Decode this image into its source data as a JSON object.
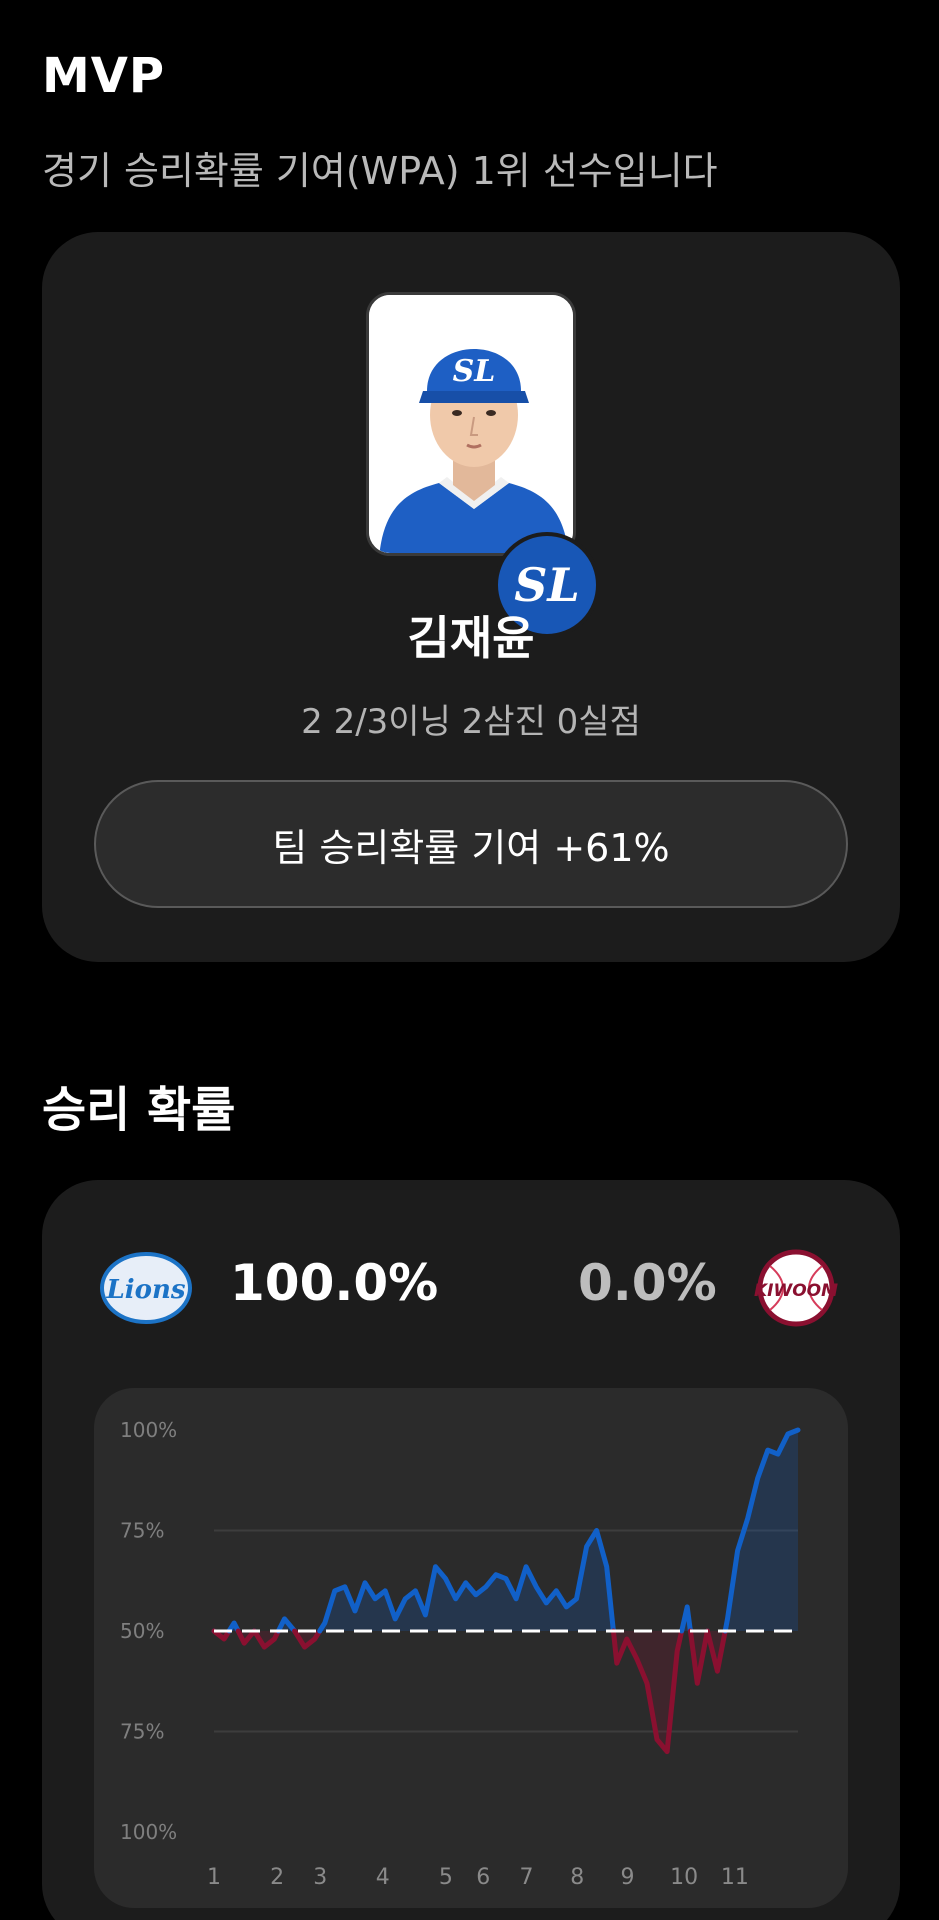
{
  "mvp": {
    "title": "MVP",
    "subtitle": "경기 승리확률 기여(WPA) 1위 선수입니다",
    "player_name": "김재윤",
    "player_stats": "2 2/3이닝 2삼진 0실점",
    "team_badge": "SL",
    "wpa_button_label": "팀 승리확률 기여 +61%"
  },
  "win_probability": {
    "title": "승리 확률",
    "home_team_logo": "Lions",
    "home_pct": "100.0%",
    "away_team_logo": "KIWOOM",
    "away_pct": "0.0%",
    "colors": {
      "home": "#1160c8",
      "away": "#8a1030",
      "baseline": "#ffffff"
    }
  },
  "chart_data": {
    "type": "area",
    "y_tick_labels": [
      "100%",
      "75%",
      "50%",
      "75%",
      "100%"
    ],
    "x_tick_labels": [
      "1",
      "2",
      "3",
      "4",
      "5",
      "6",
      "7",
      "8",
      "9",
      "10",
      "11"
    ],
    "baseline": 50,
    "ylim": [
      0,
      100
    ],
    "x_positions": [
      1,
      2,
      3,
      4,
      5,
      6,
      7,
      8,
      9,
      10,
      11
    ],
    "series": [
      {
        "values": [
          50,
          48,
          52,
          47,
          50,
          46,
          48,
          53,
          50,
          46,
          48,
          52,
          60,
          61,
          55,
          62,
          58,
          60,
          53,
          58,
          60,
          54,
          66,
          63,
          58,
          62,
          59,
          61,
          64,
          63,
          58,
          66,
          61,
          57,
          60,
          56,
          58,
          71,
          75,
          66,
          42,
          48,
          43,
          37,
          23,
          20,
          45,
          56,
          37,
          50,
          40,
          53,
          70,
          78,
          88,
          95,
          94,
          99,
          100
        ]
      }
    ]
  }
}
